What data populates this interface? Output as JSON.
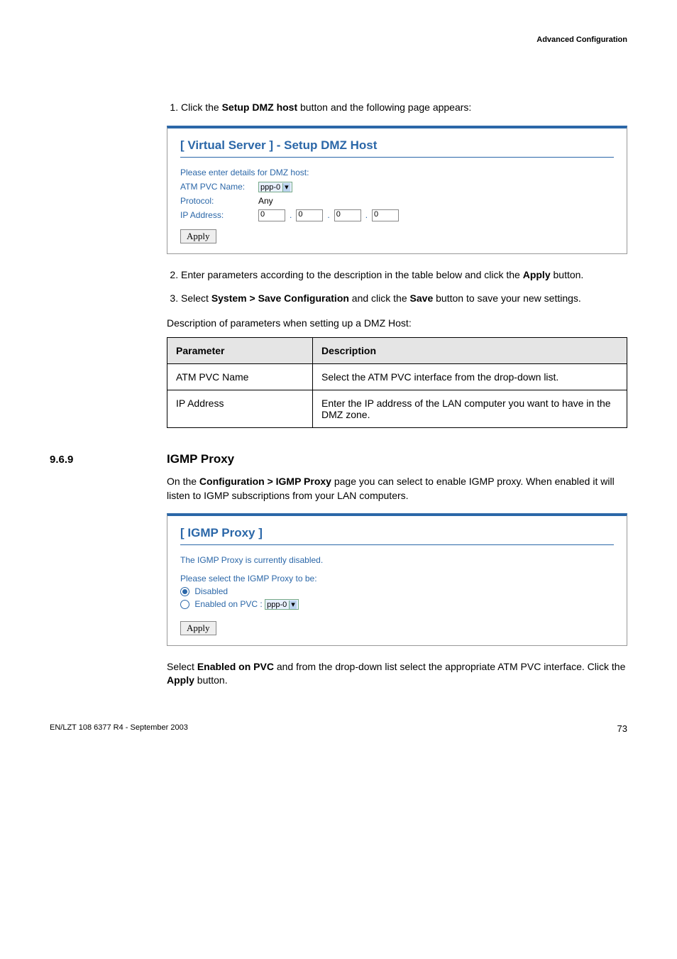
{
  "header": {
    "right": "Advanced Configuration"
  },
  "steps1": {
    "s1_pre": "Click the ",
    "s1_bold": "Setup DMZ host",
    "s1_post": " button and the following page appears:"
  },
  "fig1": {
    "title": "[ Virtual Server ] - Setup DMZ Host",
    "intro": "Please enter details for DMZ host:",
    "atm_label": "ATM PVC Name:",
    "atm_value": "ppp-0",
    "proto_label": "Protocol:",
    "proto_value": "Any",
    "ip_label": "IP Address:",
    "ip": [
      "0",
      "0",
      "0",
      "0"
    ],
    "apply": "Apply"
  },
  "steps2": {
    "s2_pre": "Enter parameters according to the description in the table below and click the ",
    "s2_bold": "Apply",
    "s2_post": " button.",
    "s3_a": "Select ",
    "s3_b": "System > Save Configuration",
    "s3_c": " and click the ",
    "s3_d": "Save",
    "s3_e": " button to save your new settings."
  },
  "table_intro": "Description of parameters when setting up a DMZ Host:",
  "table": {
    "h1": "Parameter",
    "h2": "Description",
    "r1c1": "ATM PVC Name",
    "r1c2": "Select the ATM PVC interface from the drop-down list.",
    "r2c1": "IP Address",
    "r2c2": "Enter the IP address of the LAN computer you want to have in the DMZ zone."
  },
  "section": {
    "num": "9.6.9",
    "title": "IGMP Proxy"
  },
  "igmp_para": {
    "a": "On the ",
    "b": "Configuration > IGMP Proxy",
    "c": " page you can select to enable IGMP proxy.  When enabled it will listen to IGMP subscriptions from your LAN computers."
  },
  "fig2": {
    "title": "[ IGMP Proxy ]",
    "status": "The IGMP Proxy is currently disabled.",
    "prompt": "Please select the IGMP Proxy to be:",
    "opt_disabled": "Disabled",
    "opt_enabled": "Enabled on PVC :",
    "pvc_value": "ppp-0",
    "apply": "Apply"
  },
  "closing": {
    "a": "Select ",
    "b": "Enabled on PVC",
    "c": " and from the drop-down list select the appropriate ATM PVC interface.  Click the ",
    "d": "Apply",
    "e": " button."
  },
  "footer": {
    "left": "EN/LZT 108 6377 R4 - September 2003",
    "page": "73"
  }
}
